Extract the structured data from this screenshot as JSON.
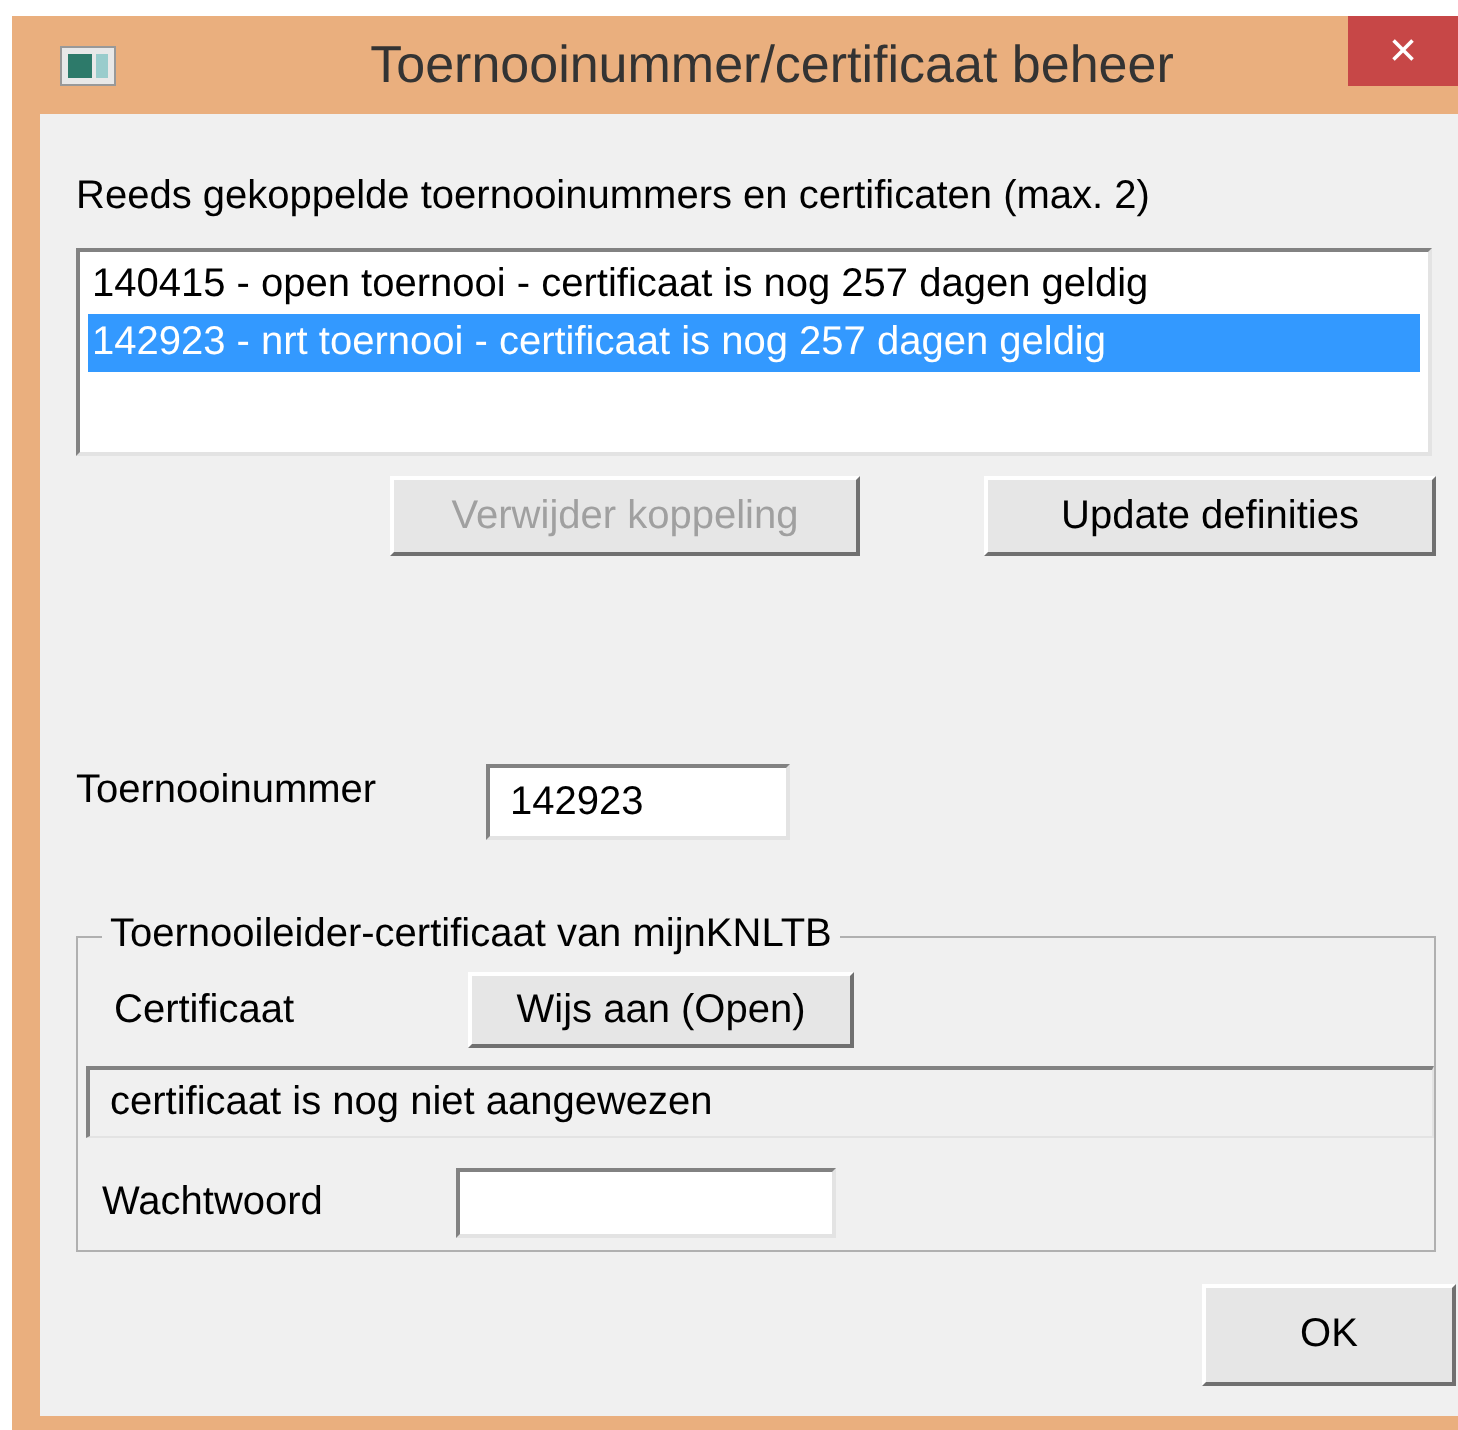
{
  "window": {
    "title": "Toernooinummer/certificaat beheer",
    "close": "×"
  },
  "list_label": "Reeds gekoppelde toernooinummers en certificaten (max. 2)",
  "list": [
    {
      "text": "140415 - open toernooi - certificaat is nog 257 dagen geldig",
      "selected": false
    },
    {
      "text": "142923 - nrt toernooi - certificaat is nog 257 dagen geldig",
      "selected": true
    }
  ],
  "list_buttons": [
    {
      "label": "Verwijder koppeling",
      "disabled": true
    },
    {
      "label": "Update definities",
      "disabled": false
    }
  ],
  "toernooinummer": {
    "label": "Toernooinummer",
    "value": "142923"
  },
  "group": {
    "legend": "Toernooileider-certificaat van mijnKNLTB",
    "certificate_label": "Certificaat",
    "certificate_button": "Wijs aan (Open)",
    "status": "certificaat is nog niet aangewezen",
    "password_label": "Wachtwoord"
  },
  "ok_button": "OK"
}
